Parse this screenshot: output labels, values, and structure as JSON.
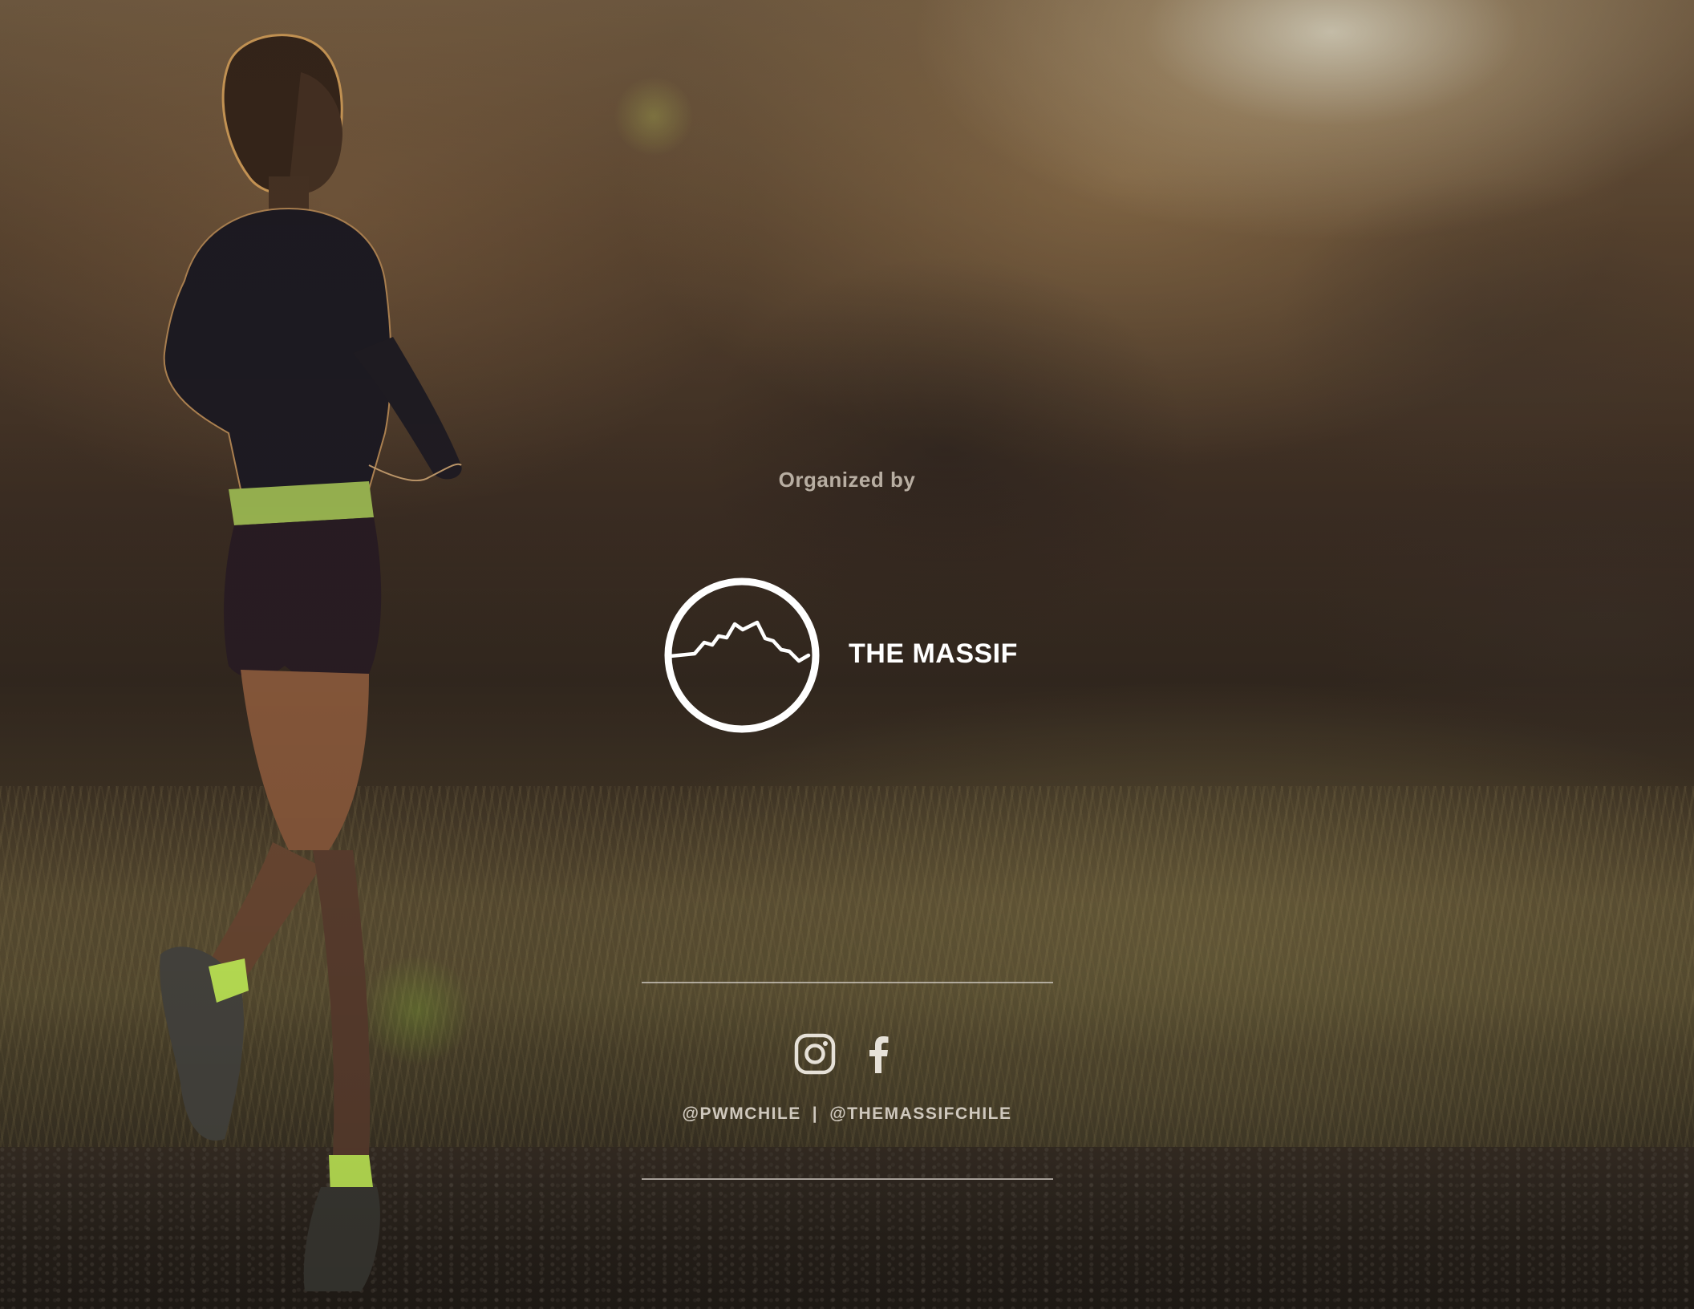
{
  "organized_label": "Organized by",
  "organizer": {
    "name": "THE MASSIF",
    "logo_icon": "mountain-circle-logo"
  },
  "social": {
    "icons": [
      "instagram-icon",
      "facebook-icon"
    ],
    "handle_primary": "@PWMCHILE",
    "separator": "|",
    "handle_secondary": "@THEMASSIFCHILE"
  },
  "colors": {
    "text_light": "#ffffff",
    "text_muted": "#b8aea2",
    "accent_neon": "#c8f25a"
  }
}
